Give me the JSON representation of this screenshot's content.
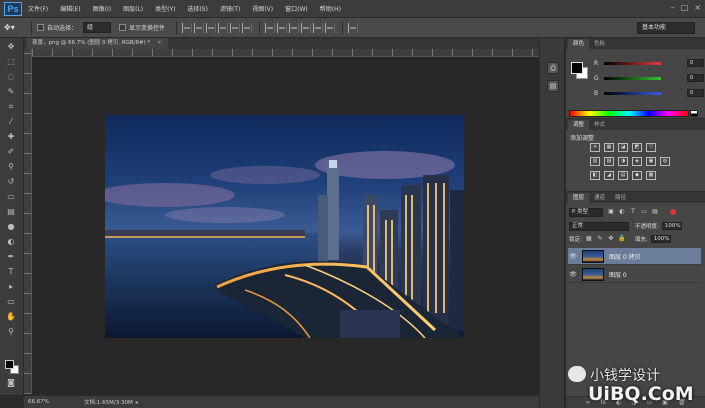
{
  "app": {
    "logo": "Ps"
  },
  "menu": [
    "文件(F)",
    "编辑(E)",
    "图像(I)",
    "图层(L)",
    "类型(Y)",
    "选择(S)",
    "滤镜(T)",
    "视图(V)",
    "窗口(W)",
    "帮助(H)"
  ],
  "window_controls": {
    "minimize": "–",
    "maximize": "□",
    "close": "×"
  },
  "options": {
    "auto_select_label": "自动选择：",
    "auto_select_value": "组",
    "show_transform_label": "显示变换控件",
    "workspace": "基本功能"
  },
  "document": {
    "tab_title": "夜景，png @ 66.7% (图层 0 拷贝, RGB/8#) *",
    "close": "×"
  },
  "status": {
    "zoom": "66.67%",
    "doc_info": "文档:1.65M/3.30M",
    "arrow": "▸"
  },
  "toolbox": {
    "tools": [
      "move-tool",
      "marquee-tool",
      "lasso-tool",
      "quick-select-tool",
      "crop-tool",
      "eyedropper-tool",
      "healing-tool",
      "brush-tool",
      "stamp-tool",
      "history-brush-tool",
      "eraser-tool",
      "gradient-tool",
      "blur-tool",
      "dodge-tool",
      "pen-tool",
      "type-tool",
      "path-select-tool",
      "shape-tool",
      "hand-tool",
      "zoom-tool"
    ],
    "glyphs": [
      "✥",
      "⬚",
      "◌",
      "✎",
      "⌗",
      "⁄",
      "✚",
      "✐",
      "⚲",
      "↺",
      "▭",
      "▤",
      "●",
      "◐",
      "✒",
      "T",
      "▸",
      "▭",
      "✋",
      "⚲"
    ]
  },
  "color_panel": {
    "tabs": [
      "颜色",
      "色板"
    ],
    "channels": [
      {
        "name": "R",
        "value": "0",
        "color": "#e23b3b"
      },
      {
        "name": "G",
        "value": "0",
        "color": "#34c434"
      },
      {
        "name": "B",
        "value": "0",
        "color": "#3a5ee8"
      }
    ]
  },
  "adjustments": {
    "tabs": [
      "调整",
      "样式"
    ],
    "title": "添加调整",
    "rows": [
      [
        "☀",
        "▦",
        "◪",
        "◩",
        "▽"
      ],
      [
        "▥",
        "▨",
        "◑",
        "◈",
        "▣",
        "◍"
      ],
      [
        "◧",
        "◢",
        "▤",
        "◆",
        "▩"
      ]
    ]
  },
  "layers": {
    "tabs": [
      "图层",
      "通道",
      "路径"
    ],
    "kind": "P 类型",
    "blend_mode": "正常",
    "opacity_label": "不透明度:",
    "opacity": "100%",
    "lock_label": "锁定:",
    "fill_label": "填充:",
    "fill": "100%",
    "items": [
      {
        "name": "图层 0 拷贝",
        "selected": true
      },
      {
        "name": "图层 0",
        "selected": false
      }
    ],
    "footer": [
      "∞",
      "fx",
      "◐",
      "◑",
      "▭",
      "▣",
      "🗑"
    ]
  },
  "watermark": {
    "text": "小钱学设计",
    "site": "UiBQ.CoM"
  }
}
